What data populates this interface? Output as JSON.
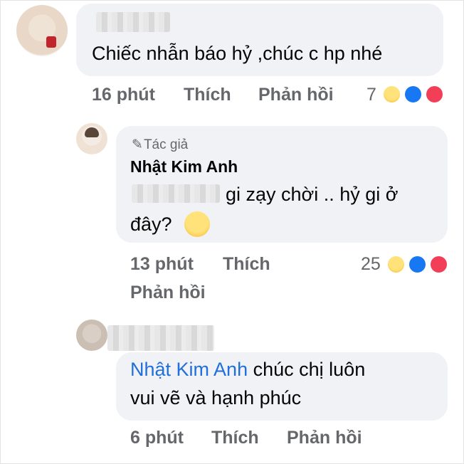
{
  "comments": [
    {
      "author_name": "",
      "text": "Chiếc nhẫn báo hỷ ,chúc c hp nhé",
      "time": "16 phút",
      "like_label": "Thích",
      "reply_label": "Phản hồi",
      "reaction_count": "7",
      "reactions": [
        "haha-icon",
        "like-icon",
        "love-icon"
      ]
    },
    {
      "author_tag": "Tác giả",
      "author_name": "Nhật Kim Anh",
      "text_line1": "gi zạy chời .. hỷ gi ở",
      "text_line2": "đây?",
      "time": "13 phút",
      "like_label": "Thích",
      "reply_label": "Phản hồi",
      "reaction_count": "25",
      "reactions": [
        "haha-icon",
        "like-icon",
        "love-icon"
      ]
    },
    {
      "author_name": "",
      "mention": "Nhật Kim Anh",
      "text_line1": "chúc chị luôn",
      "text_line2": "vui vẽ và hạnh phúc",
      "time": "6 phút",
      "like_label": "Thích",
      "reply_label": "Phản hồi"
    }
  ],
  "colors": {
    "bubble": "#f0f2f5",
    "meta_text": "#65676b",
    "mention": "#216fdb",
    "like": "#1877f2",
    "love": "#f33e58",
    "haha": "#f7b125"
  }
}
